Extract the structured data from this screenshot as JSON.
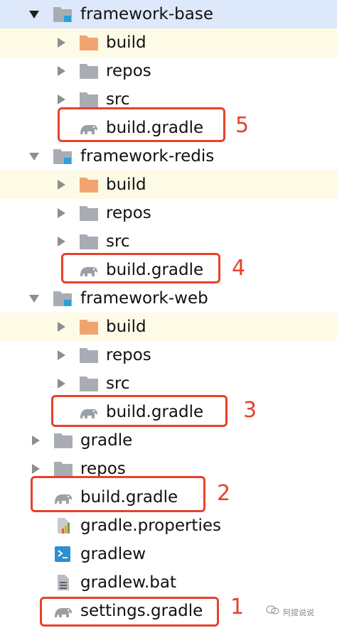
{
  "tree": [
    {
      "label": "framework-base",
      "type": "module",
      "expanded": true
    },
    {
      "label": "build",
      "type": "folder-orange"
    },
    {
      "label": "repos",
      "type": "folder"
    },
    {
      "label": "src",
      "type": "folder"
    },
    {
      "label": "build.gradle",
      "type": "gradle"
    },
    {
      "label": "framework-redis",
      "type": "module",
      "expanded": true
    },
    {
      "label": "build",
      "type": "folder-orange"
    },
    {
      "label": "repos",
      "type": "folder"
    },
    {
      "label": "src",
      "type": "folder"
    },
    {
      "label": "build.gradle",
      "type": "gradle"
    },
    {
      "label": "framework-web",
      "type": "module",
      "expanded": true
    },
    {
      "label": "build",
      "type": "folder-orange"
    },
    {
      "label": "repos",
      "type": "folder"
    },
    {
      "label": "src",
      "type": "folder"
    },
    {
      "label": "build.gradle",
      "type": "gradle"
    },
    {
      "label": "gradle",
      "type": "folder"
    },
    {
      "label": "repos",
      "type": "folder"
    },
    {
      "label": "build.gradle",
      "type": "gradle"
    },
    {
      "label": "gradle.properties",
      "type": "properties"
    },
    {
      "label": "gradlew",
      "type": "shell"
    },
    {
      "label": "gradlew.bat",
      "type": "text-file"
    },
    {
      "label": "settings.gradle",
      "type": "gradle"
    }
  ],
  "annotations": [
    "5",
    "4",
    "3",
    "2",
    "1"
  ],
  "watermark": "阿提说说",
  "colors": {
    "highlight": "#e8412a",
    "folder": "#a9adb3",
    "folder_orange": "#f2a46f",
    "module_badge": "#2d9fdb"
  }
}
